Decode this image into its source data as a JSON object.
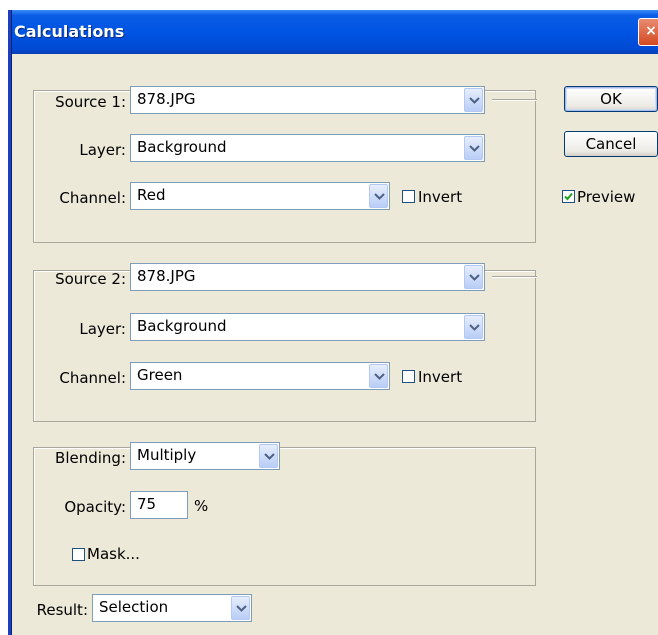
{
  "window": {
    "title": "Calculations",
    "close_glyph": "×"
  },
  "source1": {
    "label": "Source 1:",
    "value": "878.JPG",
    "layer_label": "Layer:",
    "layer_value": "Background",
    "channel_label": "Channel:",
    "channel_value": "Red",
    "invert_label": "Invert",
    "invert_checked": false
  },
  "source2": {
    "label": "Source 2:",
    "value": "878.JPG",
    "layer_label": "Layer:",
    "layer_value": "Background",
    "channel_label": "Channel:",
    "channel_value": "Green",
    "invert_label": "Invert",
    "invert_checked": false
  },
  "blending": {
    "label": "Blending:",
    "value": "Multiply",
    "opacity_label": "Opacity:",
    "opacity_value": "75",
    "opacity_unit": "%",
    "mask_label": "Mask...",
    "mask_checked": false
  },
  "result": {
    "label": "Result:",
    "value": "Selection"
  },
  "buttons": {
    "ok": "OK",
    "cancel": "Cancel"
  },
  "preview": {
    "label": "Preview",
    "checked": true
  },
  "icons": {
    "dropdown": "chevron-down-icon",
    "check": "checkmark-icon",
    "close": "close-icon"
  },
  "colors": {
    "titlebar": "#0054e3",
    "dialog_bg": "#ece9d8",
    "field_border": "#7f9db9",
    "check": "#21a121"
  }
}
